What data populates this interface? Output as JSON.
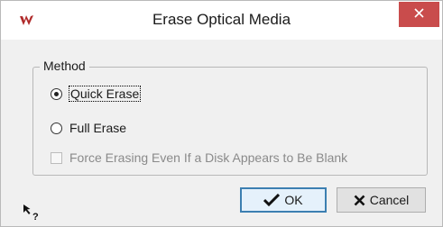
{
  "window": {
    "title": "Erase Optical Media",
    "app_icon": "wavelab-logo-icon",
    "close_icon": "close-icon",
    "close_color": "#c94c4c"
  },
  "method": {
    "legend": "Method",
    "options": [
      {
        "label": "Quick Erase",
        "checked": true,
        "focused": true
      },
      {
        "label": "Full Erase",
        "checked": false
      }
    ],
    "force_checkbox": {
      "label": "Force Erasing Even If a Disk Appears to Be Blank",
      "checked": false,
      "enabled": false
    }
  },
  "buttons": {
    "ok_label": "OK",
    "ok_icon": "checkmark-icon",
    "cancel_label": "Cancel",
    "cancel_icon": "x-icon"
  },
  "help": {
    "icon": "whats-this-help-icon"
  }
}
